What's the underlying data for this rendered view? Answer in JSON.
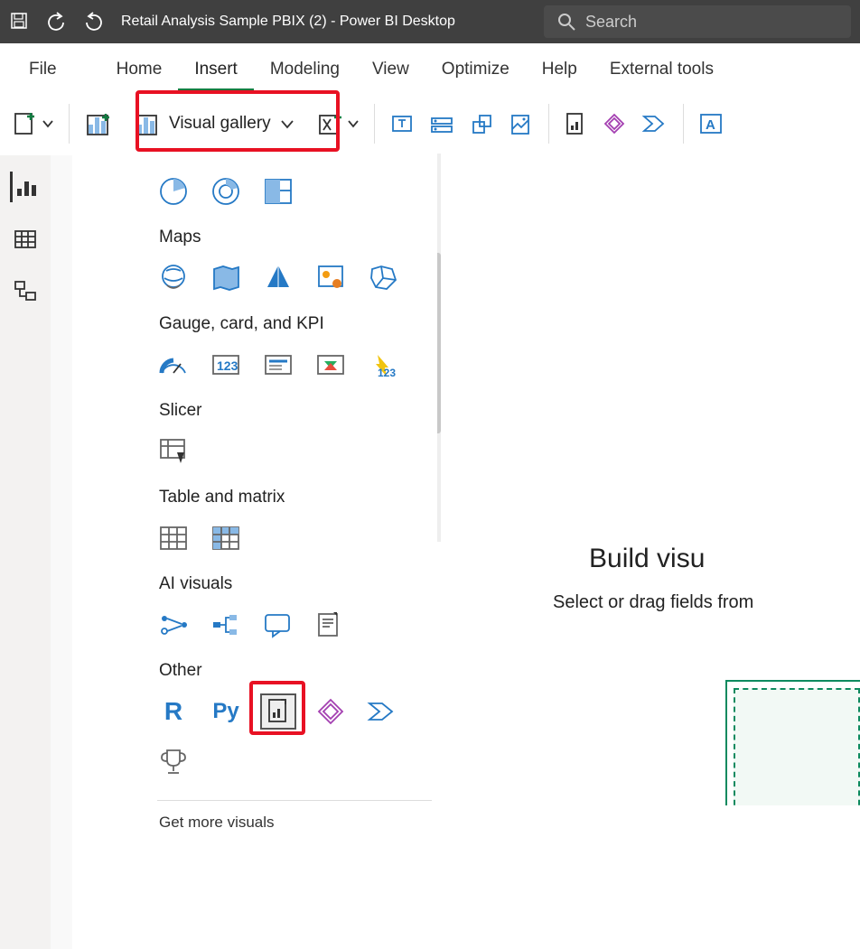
{
  "window": {
    "title": "Retail Analysis Sample PBIX (2) - Power BI Desktop",
    "search_placeholder": "Search"
  },
  "menu": {
    "tabs": [
      "File",
      "Home",
      "Insert",
      "Modeling",
      "View",
      "Optimize",
      "Help",
      "External tools"
    ],
    "active": "Insert"
  },
  "ribbon": {
    "visual_gallery_label": "Visual gallery"
  },
  "visual_gallery": {
    "sections": [
      {
        "title": "Maps"
      },
      {
        "title": "Gauge, card, and KPI"
      },
      {
        "title": "Slicer"
      },
      {
        "title": "Table and matrix"
      },
      {
        "title": "AI visuals"
      },
      {
        "title": "Other"
      }
    ],
    "more_link": "Get more visuals",
    "other_items": [
      "R",
      "Py"
    ]
  },
  "canvas_hint": {
    "title": "Build visu",
    "subtitle": "Select or drag fields from"
  }
}
